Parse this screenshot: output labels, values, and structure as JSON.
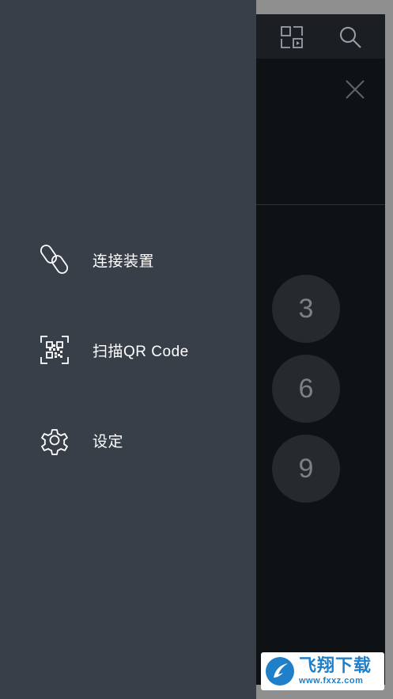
{
  "background_app": {
    "keypad": [
      "3",
      "6",
      "9"
    ]
  },
  "drawer": {
    "items": [
      {
        "label": "连接装置",
        "icon": "link-icon"
      },
      {
        "label": "扫描QR Code",
        "icon": "qr-scan-icon"
      },
      {
        "label": "设定",
        "icon": "gear-icon"
      }
    ]
  },
  "watermark": {
    "title": "飞翔下载",
    "url": "www.fxxz.com"
  },
  "colors": {
    "drawer_bg": "#393f49",
    "app_bg": "#0f1215",
    "brand_blue": "#1f7fc9"
  }
}
